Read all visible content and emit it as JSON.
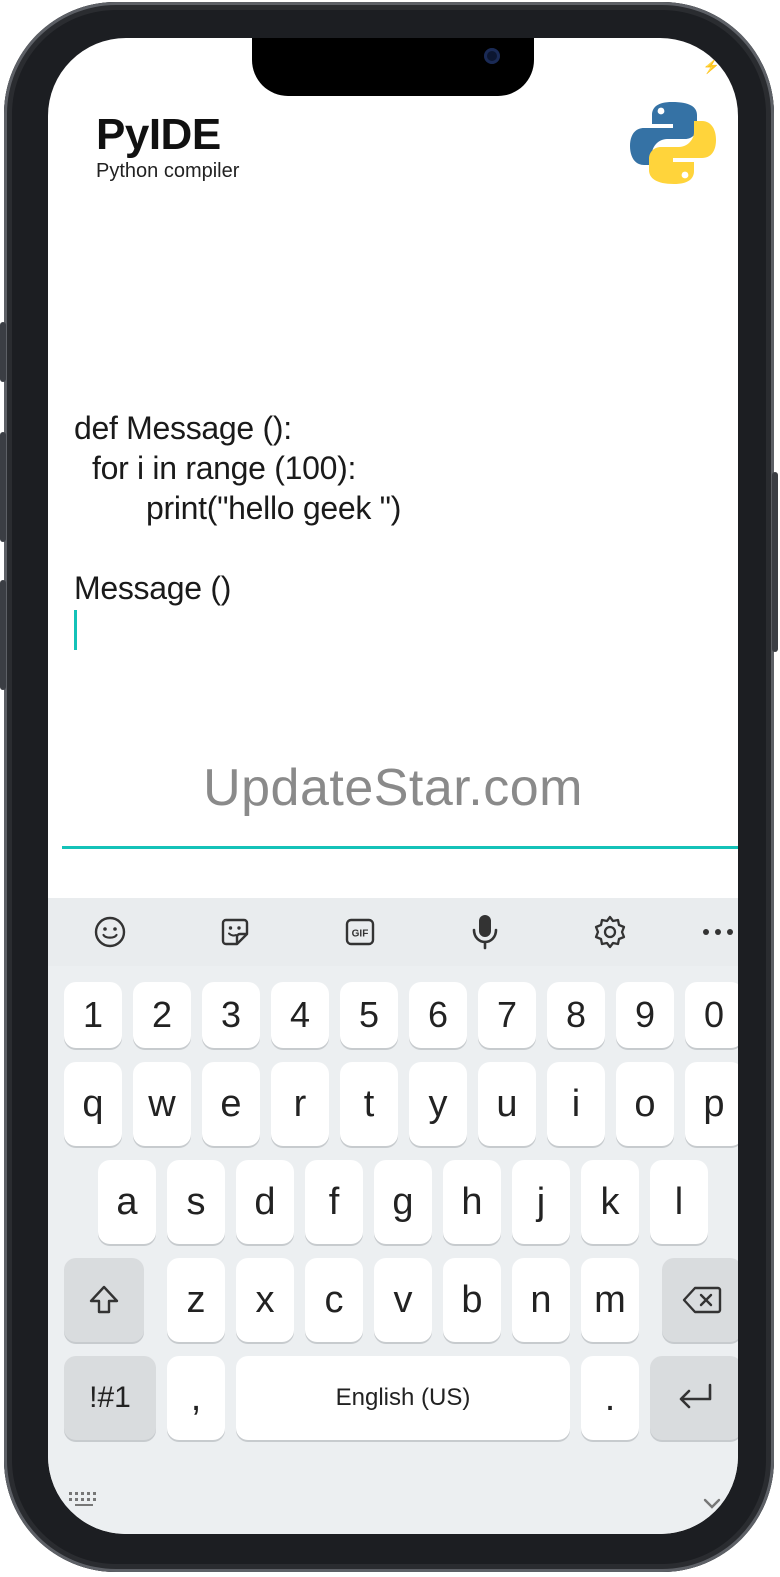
{
  "app": {
    "title": "PyIDE",
    "subtitle": "Python compiler",
    "logo_icon": "python-logo-icon",
    "colors": {
      "accent": "#14c2b8",
      "python_blue": "#3572a5",
      "python_yellow": "#ffd43b"
    }
  },
  "editor": {
    "lines": [
      "def Message ():",
      "for i in range (100):",
      "print(\"hello geek \")",
      "",
      "Message ()"
    ]
  },
  "watermark": "UpdateStar.com",
  "keyboard": {
    "toolbar": [
      "emoji-icon",
      "sticker-icon",
      "gif-icon",
      "microphone-icon",
      "settings-icon",
      "more-icon"
    ],
    "number_row": [
      "1",
      "2",
      "3",
      "4",
      "5",
      "6",
      "7",
      "8",
      "9",
      "0"
    ],
    "row1": [
      "q",
      "w",
      "e",
      "r",
      "t",
      "y",
      "u",
      "i",
      "o",
      "p"
    ],
    "row2": [
      "a",
      "s",
      "d",
      "f",
      "g",
      "h",
      "j",
      "k",
      "l"
    ],
    "row3": [
      "z",
      "x",
      "c",
      "v",
      "b",
      "n",
      "m"
    ],
    "symbols_label": "!#1",
    "comma": ",",
    "space_label": "English (US)",
    "period": ".",
    "shift_icon": "shift-icon",
    "backspace_icon": "backspace-icon",
    "enter_icon": "enter-icon"
  }
}
